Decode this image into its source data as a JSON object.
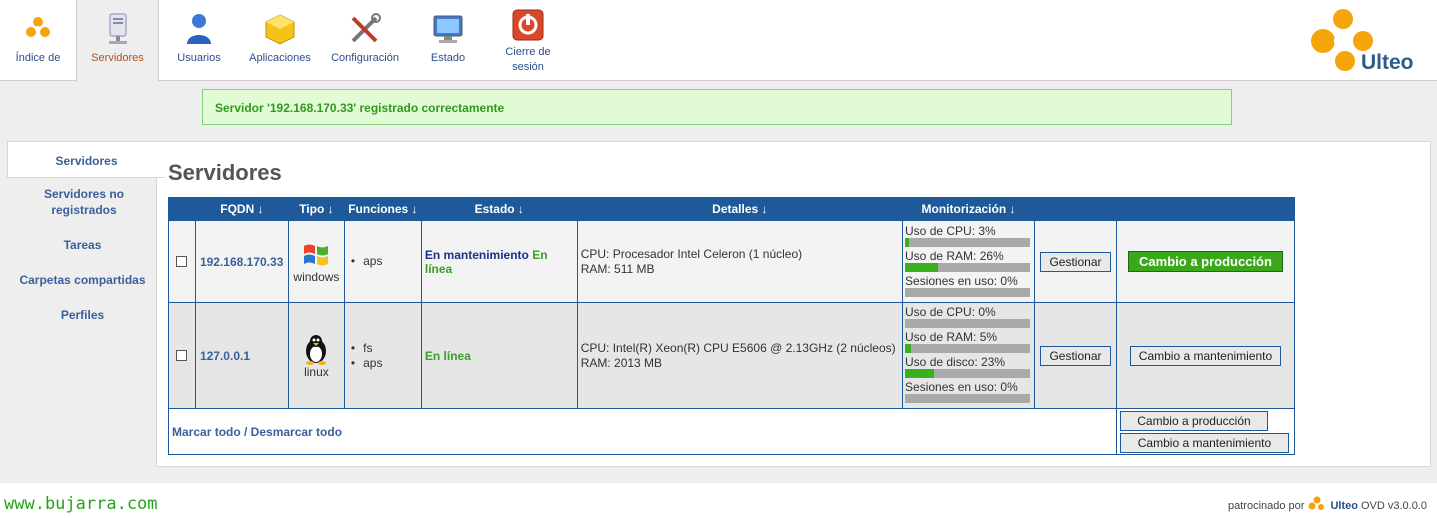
{
  "nav": [
    {
      "label": "Índice de",
      "icon": "home-icon"
    },
    {
      "label": "Servidores",
      "icon": "server-icon"
    },
    {
      "label": "Usuarios",
      "icon": "users-icon"
    },
    {
      "label": "Aplicaciones",
      "icon": "applications-icon"
    },
    {
      "label": "Configuración",
      "icon": "configuration-icon"
    },
    {
      "label": "Estado",
      "icon": "status-monitor-icon"
    },
    {
      "label": "Cierre de sesión",
      "icon": "logout-icon"
    }
  ],
  "brand": {
    "logo_text": "Ulteo",
    "accent": "#f5a50a"
  },
  "flash": "Servidor '192.168.170.33' registrado correctamente",
  "sidebar": [
    "Servidores",
    "Servidores no registrados",
    "Tareas",
    "Carpetas compartidas",
    "Perfiles"
  ],
  "page_title": "Servidores",
  "table": {
    "headers": {
      "fqdn": "FQDN ↓",
      "tipo": "Tipo ↓",
      "funciones": "Funciones ↓",
      "estado": "Estado ↓",
      "detalles": "Detalles ↓",
      "monitorizacion": "Monitorización ↓"
    },
    "rows": [
      {
        "fqdn": "192.168.170.33",
        "tipo": "windows",
        "os_icon": "windows-icon",
        "funciones": [
          "aps"
        ],
        "estado_mant": "En mantenimiento",
        "estado_line": "En línea",
        "cpu": "CPU: Procesador Intel Celeron (1 núcleo)",
        "ram": "RAM: 511 MB",
        "monitor": [
          {
            "label": "Uso de CPU: 3%",
            "value": 3
          },
          {
            "label": "Uso de RAM: 26%",
            "value": 26
          },
          {
            "label": "Sesiones en uso: 0%",
            "value": 0
          }
        ],
        "manage": "Gestionar",
        "switch": "Cambio a producción"
      },
      {
        "fqdn": "127.0.0.1",
        "tipo": "linux",
        "os_icon": "linux-tux-icon",
        "funciones": [
          "fs",
          "aps"
        ],
        "estado_line": "En línea",
        "cpu": "CPU: Intel(R) Xeon(R) CPU E5606 @ 2.13GHz (2 núcleos)",
        "ram": "RAM: 2013 MB",
        "monitor": [
          {
            "label": "Uso de CPU: 0%",
            "value": 0
          },
          {
            "label": "Uso de RAM: 5%",
            "value": 5
          },
          {
            "label": "Uso de disco: 23%",
            "value": 23
          },
          {
            "label": "Sesiones en uso: 0%",
            "value": 0
          }
        ],
        "manage": "Gestionar",
        "switch": "Cambio a mantenimiento"
      }
    ],
    "mark_all": "Marcar todo / Desmarcar todo",
    "bulk_production": "Cambio a producción",
    "bulk_maintenance": "Cambio a mantenimiento"
  },
  "footer": {
    "site": "www.bujarra.com",
    "sponsor": "patrocinado por",
    "brand": "Ulteo",
    "version": "OVD v3.0.0.0"
  }
}
